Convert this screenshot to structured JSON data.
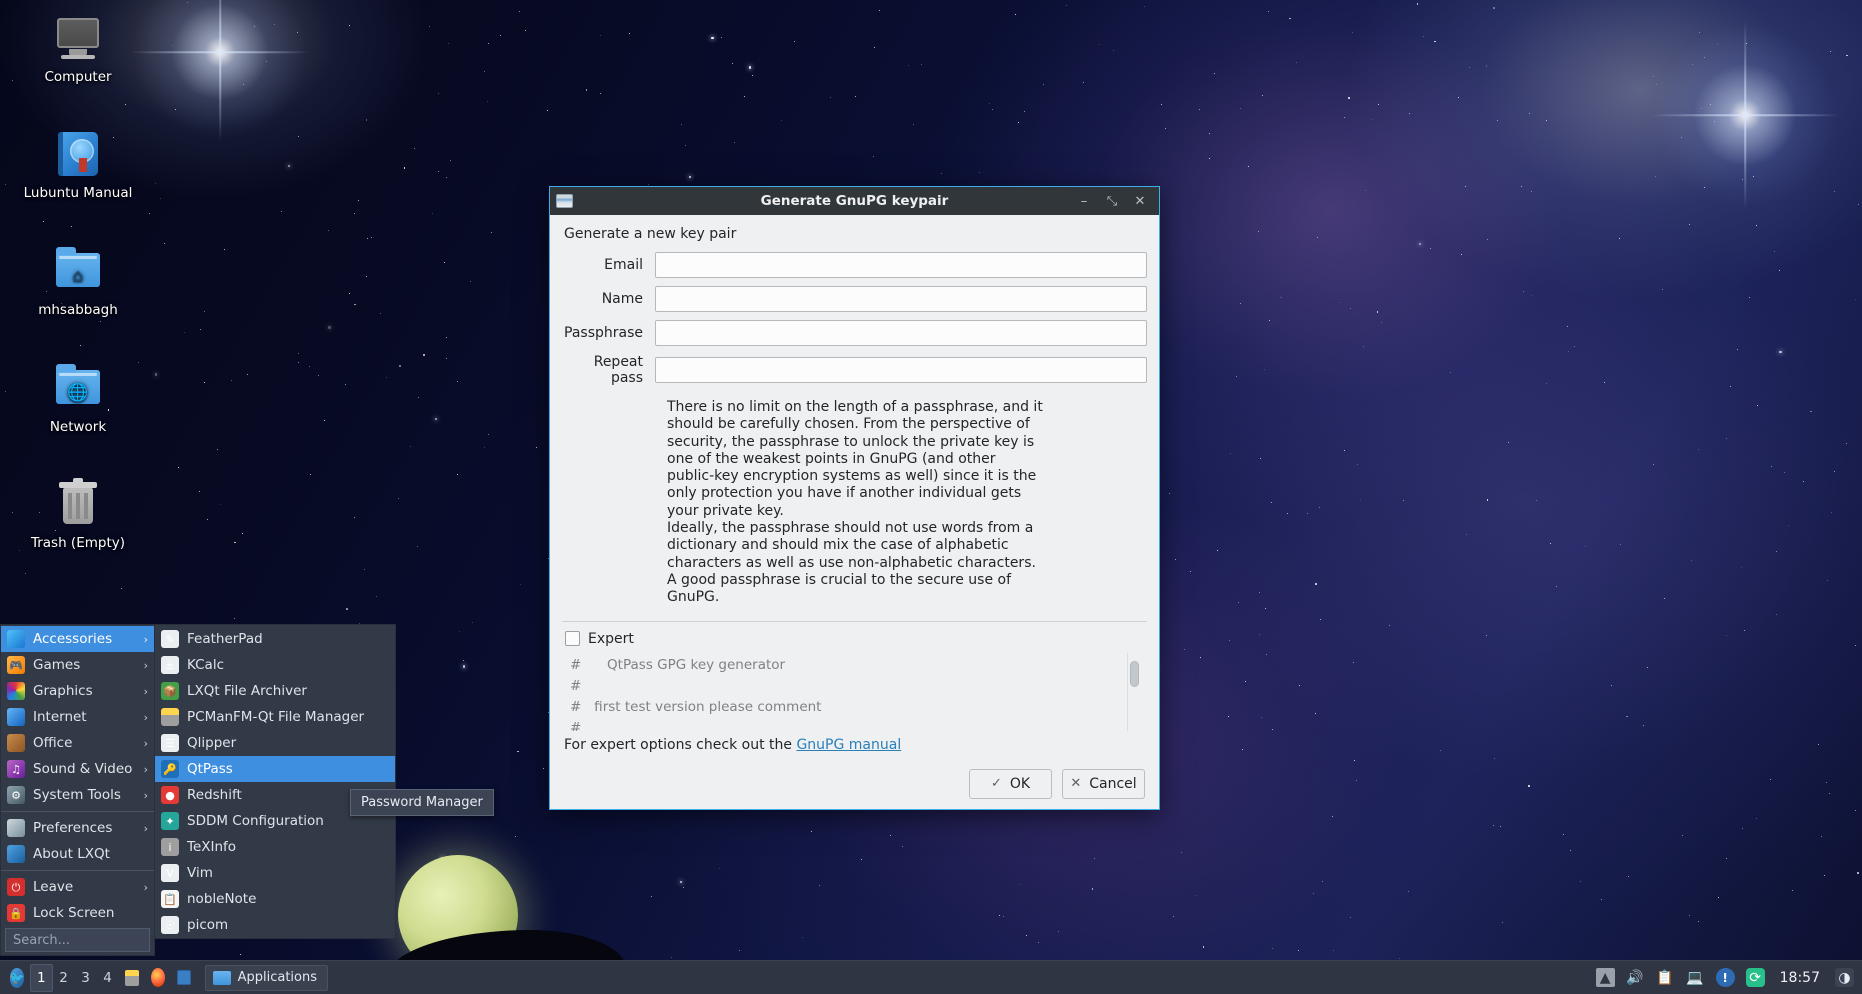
{
  "desktop": {
    "icons": [
      {
        "name": "computer",
        "label": "Computer"
      },
      {
        "name": "lubuntu-manual",
        "label": "Lubuntu Manual"
      },
      {
        "name": "home-folder",
        "label": "mhsabbagh"
      },
      {
        "name": "network-folder",
        "label": "Network"
      },
      {
        "name": "trash",
        "label": "Trash (Empty)"
      }
    ]
  },
  "app_menu": {
    "categories": [
      {
        "label": "Accessories",
        "icon": "accessories-icon",
        "arrow": "›",
        "selected": true
      },
      {
        "label": "Games",
        "icon": "games-icon",
        "arrow": "›",
        "selected": false
      },
      {
        "label": "Graphics",
        "icon": "graphics-icon",
        "arrow": "›",
        "selected": false
      },
      {
        "label": "Internet",
        "icon": "internet-icon",
        "arrow": "›",
        "selected": false
      },
      {
        "label": "Office",
        "icon": "office-icon",
        "arrow": "›",
        "selected": false
      },
      {
        "label": "Sound & Video",
        "icon": "sound-video-icon",
        "arrow": "›",
        "selected": false
      },
      {
        "label": "System Tools",
        "icon": "system-tools-icon",
        "arrow": "›",
        "selected": false
      },
      {
        "label": "Preferences",
        "icon": "preferences-icon",
        "arrow": "›",
        "selected": false
      },
      {
        "label": "About LXQt",
        "icon": "about-lxqt-icon",
        "arrow": "",
        "selected": false
      },
      {
        "label": "Leave",
        "icon": "leave-icon",
        "arrow": "›",
        "selected": false
      },
      {
        "label": "Lock Screen",
        "icon": "lock-screen-icon",
        "arrow": "",
        "selected": false
      }
    ],
    "applications": [
      {
        "label": "FeatherPad",
        "icon": "featherpad-icon",
        "selected": false
      },
      {
        "label": "KCalc",
        "icon": "kcalc-icon",
        "selected": false
      },
      {
        "label": "LXQt File Archiver",
        "icon": "archiver-icon",
        "selected": false
      },
      {
        "label": "PCManFM-Qt File Manager",
        "icon": "pcmanfm-icon",
        "selected": false
      },
      {
        "label": "Qlipper",
        "icon": "qlipper-icon",
        "selected": false
      },
      {
        "label": "QtPass",
        "icon": "qtpass-icon",
        "selected": true
      },
      {
        "label": "Redshift",
        "icon": "redshift-icon",
        "selected": false
      },
      {
        "label": "SDDM Configuration",
        "icon": "sddm-icon",
        "selected": false
      },
      {
        "label": "TeXInfo",
        "icon": "texinfo-icon",
        "selected": false
      },
      {
        "label": "Vim",
        "icon": "vim-icon",
        "selected": false
      },
      {
        "label": "nobleNote",
        "icon": "noblenote-icon",
        "selected": false
      },
      {
        "label": "picom",
        "icon": "picom-icon",
        "selected": false
      }
    ],
    "search_placeholder": "Search...",
    "tooltip": "Password Manager"
  },
  "taskbar": {
    "menu_button_icon": "lxqt-bird-icon",
    "desktops": [
      "1",
      "2",
      "3",
      "4"
    ],
    "active_desktop": "1",
    "launchers": [
      {
        "name": "file-manager-launcher",
        "icon": "pcmanfm-icon"
      },
      {
        "name": "firefox-launcher",
        "icon": "firefox-icon"
      },
      {
        "name": "terminal-launcher",
        "icon": "terminal-icon"
      }
    ],
    "window_button": {
      "label": "Applications",
      "icon": "folder-icon"
    },
    "tray": [
      {
        "name": "eject-icon",
        "glyph": "⏏"
      },
      {
        "name": "volume-icon",
        "glyph": "🔊"
      },
      {
        "name": "clipboard-icon",
        "glyph": "📋"
      },
      {
        "name": "network-icon",
        "glyph": "🖧"
      },
      {
        "name": "update-alert-icon",
        "glyph": "!"
      },
      {
        "name": "sync-icon",
        "glyph": "⟳"
      }
    ],
    "clock": "18:57",
    "show-desktop-icon": "brightness-icon"
  },
  "dialog": {
    "title": "Generate GnuPG keypair",
    "window_buttons": {
      "minimize": "–",
      "maximize": "⤡",
      "close": "✕"
    },
    "heading": "Generate a new key pair",
    "fields": [
      {
        "name": "email",
        "label": "Email",
        "value": "",
        "placeholder": ""
      },
      {
        "name": "name",
        "label": "Name",
        "value": "",
        "placeholder": ""
      },
      {
        "name": "passphrase",
        "label": "Passphrase",
        "value": "",
        "placeholder": ""
      },
      {
        "name": "repeat-pass",
        "label": "Repeat pass",
        "value": "",
        "placeholder": ""
      }
    ],
    "help_text": "There is no limit on the length of a passphrase, and it\nshould be carefully chosen. From the perspective of\nsecurity, the passphrase to unlock the private key is\none of the weakest points in GnuPG (and other\npublic-key encryption systems as well) since it is the\nonly protection you have if another individual gets\nyour private key.\nIdeally, the passphrase should not use words from a\ndictionary and should mix the case of alphabetic\ncharacters as well as use non-alphabetic characters.\nA good passphrase is crucial to the secure use of\nGnuPG.",
    "expert_label": "Expert",
    "expert_checked": false,
    "script_text": "#      QtPass GPG key generator\n#\n#   first test version please comment\n#\n%echo Generating a default key",
    "footer_prefix": "For expert options check out the ",
    "footer_link": "GnuPG manual",
    "buttons": [
      {
        "name": "ok-button",
        "label": "OK",
        "icon": "✓"
      },
      {
        "name": "cancel-button",
        "label": "Cancel",
        "icon": "✕"
      }
    ]
  },
  "colors": {
    "accent": "#3daee9",
    "titlebar": "#31363b",
    "dialog_bg": "#eff0f1",
    "menu_bg": "#333a47",
    "menu_selection": "#3f8fe0",
    "taskbar": "#2f3542",
    "link": "#2980b9"
  }
}
